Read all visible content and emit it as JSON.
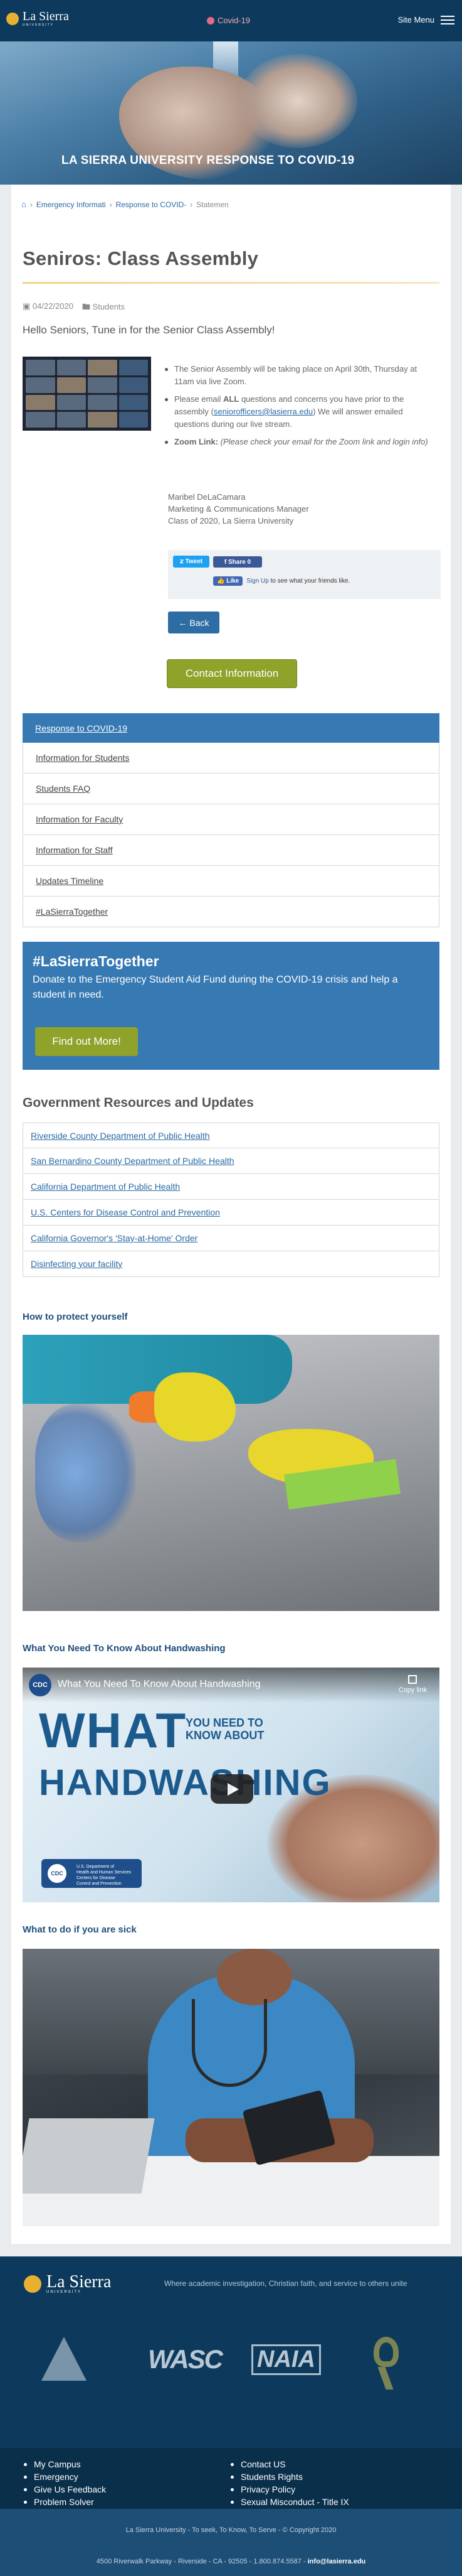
{
  "nav": {
    "logo_name": "La Sierra",
    "logo_sub": "UNIVERSITY",
    "covid_label": "Covid-19",
    "menu_label": "Site Menu"
  },
  "hero": {
    "title": "LA SIERRA UNIVERSITY RESPONSE TO COVID-19"
  },
  "breadcrumb": {
    "item1": "Emergency Informati",
    "item2": "Response to COVID-",
    "item3": "Statemen"
  },
  "article": {
    "title": "Seniros: Class Assembly",
    "date": "04/22/2020",
    "category": "Students",
    "lead": "Hello Seniors, Tune in for the Senior Class Assembly!",
    "bullet1": "The Senior Assembly will be taking place on April 30th, Thursday at 11am via live Zoom.",
    "bullet2_pre": "Please email ",
    "bullet2_bold": "ALL",
    "bullet2_mid": " questions and concerns you have prior to the assembly (",
    "bullet2_link": "seniorofficers@lasierra.edu",
    "bullet2_post": ") We will answer emailed questions during our live stream.",
    "bullet3_bold": "Zoom Link:",
    "bullet3_italic": " (Please check your email for the Zoom link and login info)",
    "sig1": "Maribel DeLaCamara",
    "sig2": "Marketing & Communications Manager",
    "sig3": "Class of 2020, La Sierra University"
  },
  "social": {
    "tweet": "Tweet",
    "share": "Share 0",
    "like": "Like",
    "signup": "Sign Up",
    "signup_rest": " to see what your friends like."
  },
  "buttons": {
    "back": "← Back",
    "contact": "Contact Information"
  },
  "accordion": {
    "head": "Response to COVID-19",
    "items": [
      "Information for Students",
      "Students FAQ",
      "Information for Faculty",
      "Information for Staff",
      "Updates Timeline",
      "#LaSierraTogether"
    ]
  },
  "donate": {
    "heading": "#LaSierraTogether",
    "text": "Donate to the Emergency Student Aid Fund during the COVID-19 crisis and help a student in need.",
    "button": "Find out More!"
  },
  "gov": {
    "title": "Government Resources and Updates",
    "links": [
      "Riverside County Department of Public Health",
      "San Bernardino County Department of Public Health",
      "California Department of Public Health",
      "U.S. Centers for Disease Control and Prevention",
      "California Governor's 'Stay-at-Home' Order",
      "Disinfecting your facility"
    ]
  },
  "protect": {
    "title": "How to protect yourself"
  },
  "handwash": {
    "title": "What You Need To Know About Handwashing",
    "video_title": "What You Need To Know About Handwashing",
    "copy_link": "Copy link",
    "cdc": "CDC",
    "big_what": "WHAT",
    "you_need": "YOU NEED TO",
    "know": "KNOW ABOUT",
    "big_hw": "HANDWASHING",
    "seal1": "U.S. Department of",
    "seal2": "Health and Human Services",
    "seal3": "Centers for Disease",
    "seal4": "Control and Prevention"
  },
  "sick": {
    "title": "What to do if you are sick"
  },
  "footer": {
    "logo_name": "La Sierra",
    "logo_sub": "UNIVERSITY",
    "tagline": "Where academic investigation, Christian faith, and service to others unite",
    "badge_wasc": "WASC",
    "badge_naia": "NAIA",
    "links_left": [
      "My Campus",
      "Emergency",
      "Give Us Feedback",
      "Problem Solver"
    ],
    "links_right": [
      "Contact US",
      "Students Rights",
      "Privacy Policy",
      "Sexual Misconduct - Title IX"
    ],
    "copyright": "La Sierra University - To seek, To Know, To Serve - © Copyright 2020",
    "address": "4500 Riverwalk Parkway - Riverside - CA - 92505 - 1.800.874.5587 - ",
    "email": "info@lasierra.edu"
  }
}
